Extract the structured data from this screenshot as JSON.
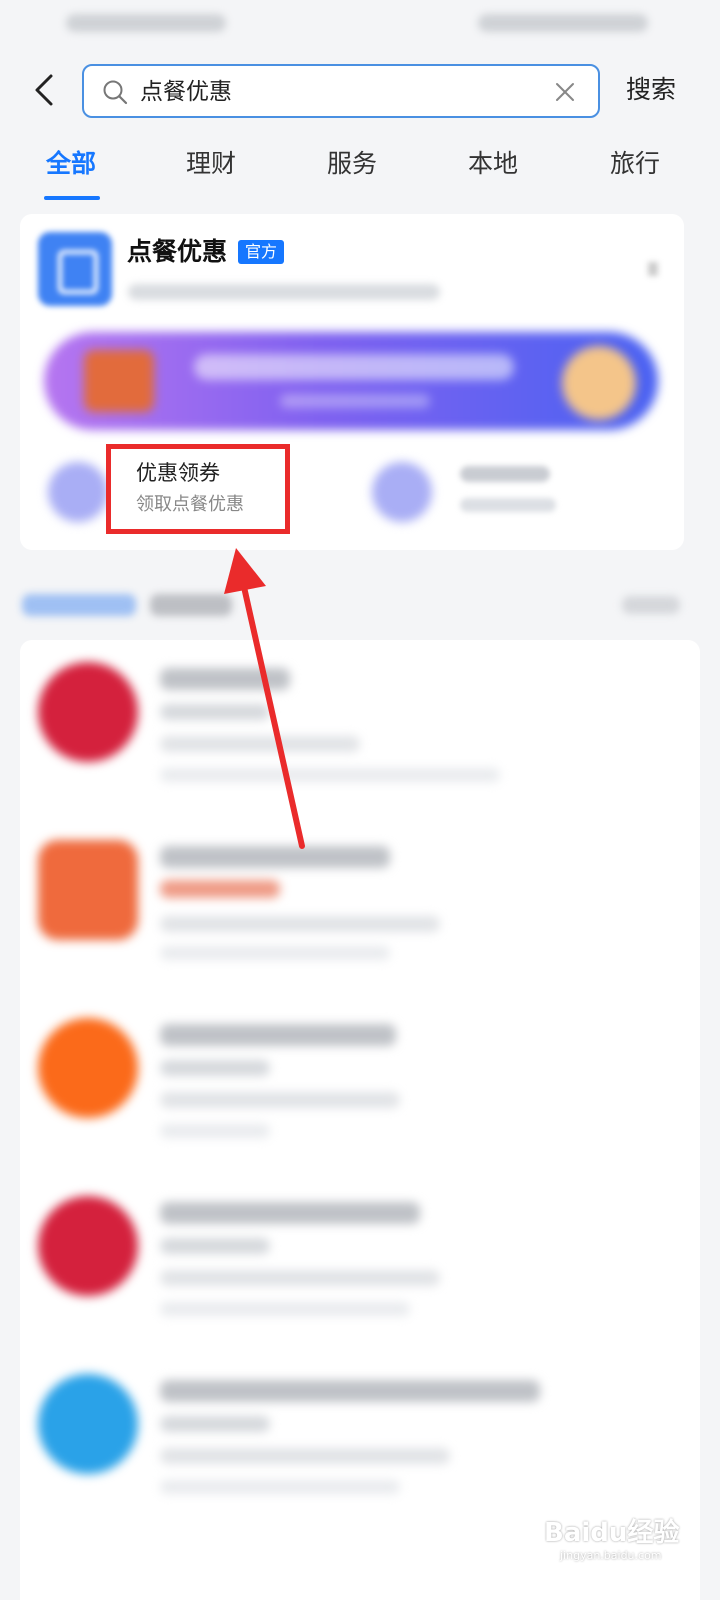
{
  "search": {
    "query": "点餐优惠",
    "button_label": "搜索"
  },
  "tabs": [
    {
      "label": "全部",
      "active": true
    },
    {
      "label": "理财"
    },
    {
      "label": "服务"
    },
    {
      "label": "本地"
    },
    {
      "label": "旅行"
    }
  ],
  "top_result": {
    "title": "点餐优惠",
    "badge": "官方"
  },
  "highlighted_service": {
    "title": "优惠领券",
    "subtitle": "领取点餐优惠"
  },
  "watermark": {
    "brand": "Baidu经验",
    "url": "jingyan.baidu.com"
  },
  "colors": {
    "accent": "#1677ff",
    "highlight_box": "#ea2b2b",
    "arrow": "#ea2b2b"
  },
  "icons": [
    "back-arrow-icon",
    "search-icon",
    "clear-icon"
  ]
}
